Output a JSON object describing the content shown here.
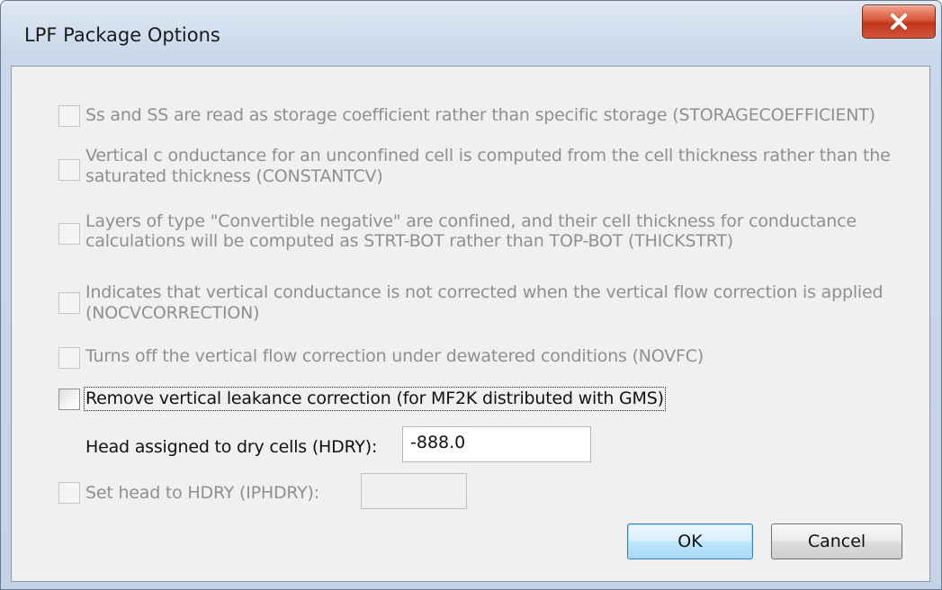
{
  "window": {
    "title": "LPF Package Options"
  },
  "options": [
    {
      "label": "Ss and SS are read as storage coefficient rather than specific storage (STORAGECOEFFICIENT)",
      "checked": false,
      "enabled": false
    },
    {
      "label_line1": "Vertical c onductance for an unconfined cell is computed from the cell thickness rather than the",
      "label_line2": "saturated thickness (CONSTANTCV)",
      "checked": false,
      "enabled": false
    },
    {
      "label_line1": "Layers of type \"Convertible negative\" are confined, and their cell thickness for conductance",
      "label_line2": "calculations will be computed as STRT-BOT rather than TOP-BOT (THICKSTRT)",
      "checked": false,
      "enabled": false
    },
    {
      "label_line1": "Indicates that vertical conductance is not corrected when the vertical flow correction is applied",
      "label_line2": "(NOCVCORRECTION)",
      "checked": false,
      "enabled": false
    },
    {
      "label": "Turns off the vertical flow correction under dewatered conditions (NOVFC)",
      "checked": false,
      "enabled": false
    },
    {
      "label": "Remove vertical leakance correction (for MF2K distributed with GMS)",
      "checked": false,
      "enabled": true
    }
  ],
  "hdry": {
    "label": "Head assigned to dry cells (HDRY):",
    "value": "-888.0"
  },
  "iphdry": {
    "label": "Set head to HDRY (IPHDRY):",
    "value": "",
    "checked": false,
    "enabled": false
  },
  "buttons": {
    "ok": "OK",
    "cancel": "Cancel"
  },
  "colors": {
    "close_button": "#c7412a",
    "disabled_text": "#8f8f8f",
    "default_button_border": "#3c7fb1"
  }
}
